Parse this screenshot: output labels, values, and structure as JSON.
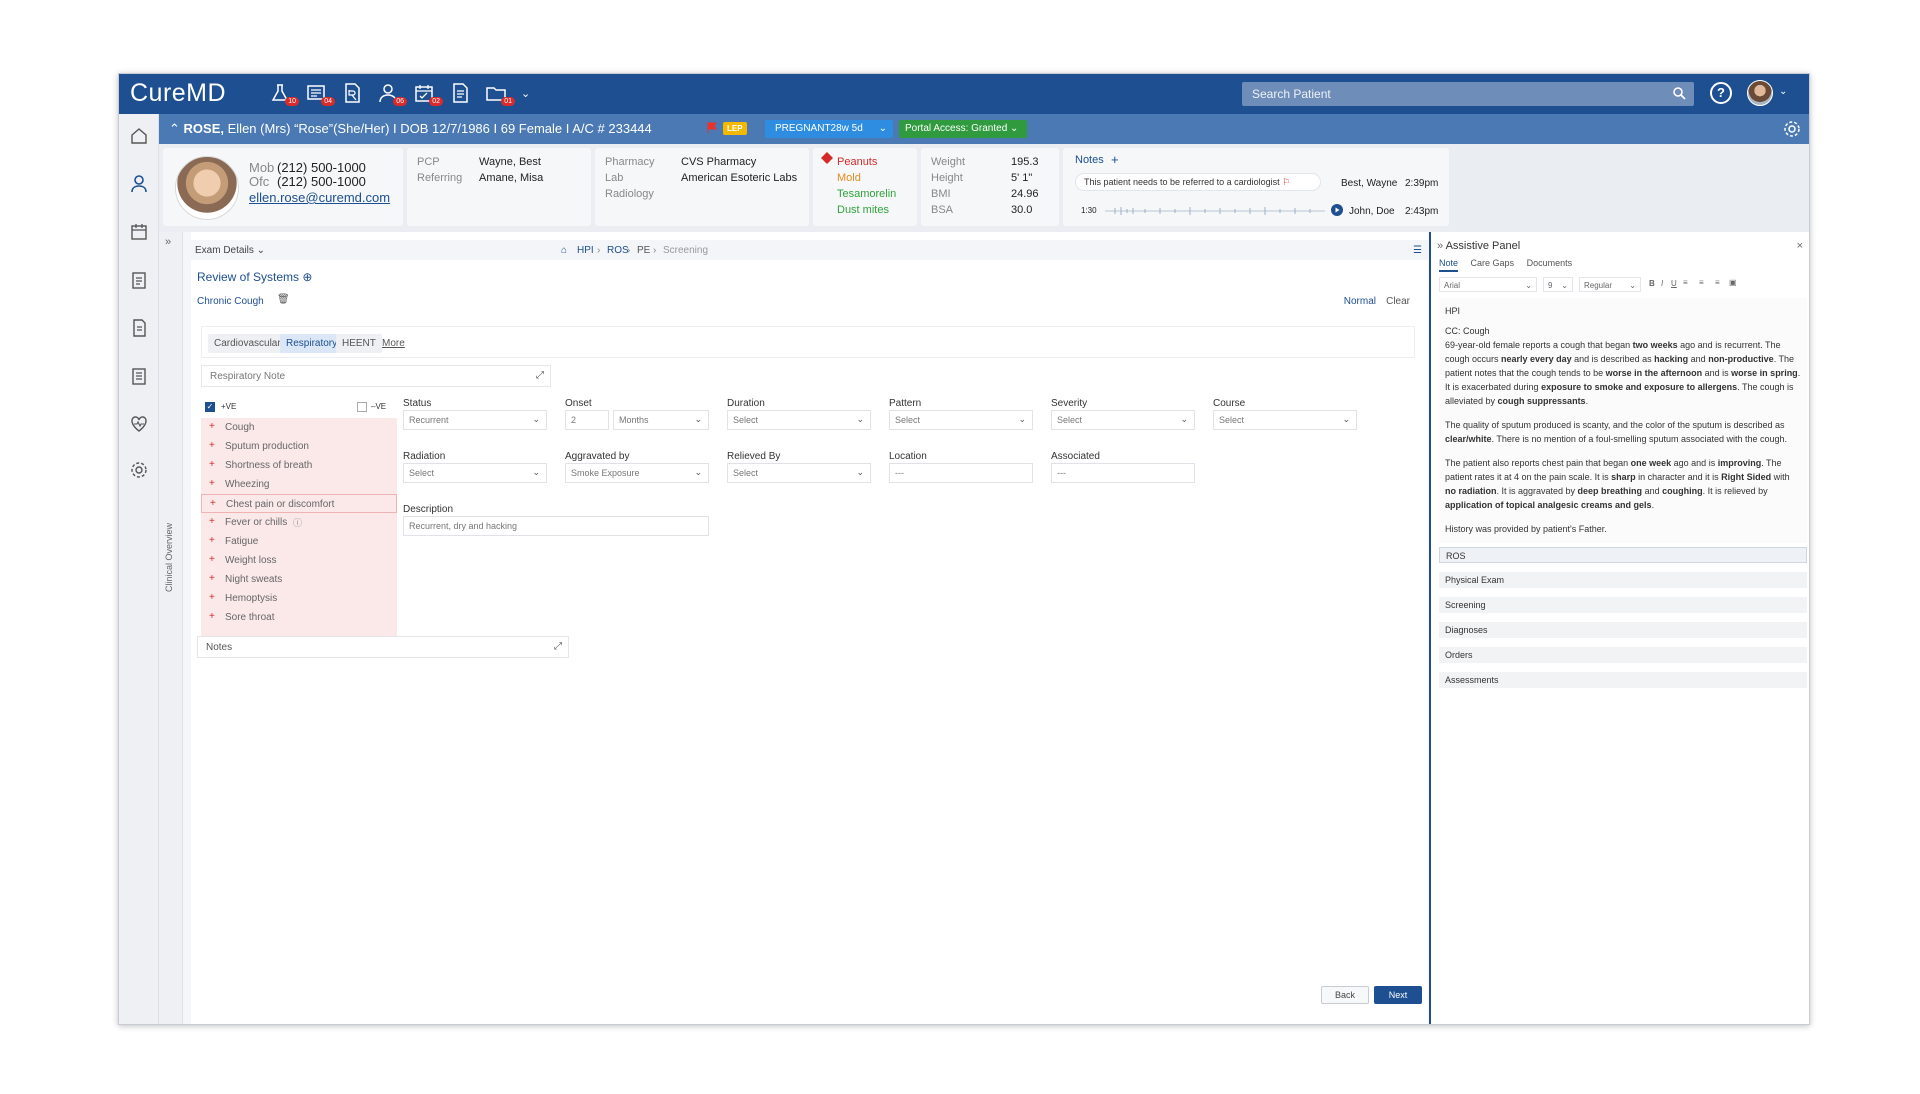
{
  "app": {
    "logo": "CureMD"
  },
  "topbar": {
    "badges": [
      "10",
      "04",
      "",
      "06",
      "02",
      "",
      "01"
    ],
    "search_placeholder": "Search Patient",
    "help": "?"
  },
  "patient": {
    "name": "ROSE,",
    "details": "Ellen (Mrs) “Rose”(She/Her) I DOB 12/7/1986 I  69 Female I  A/C # 233444",
    "lep": "LEP",
    "pregnancy": "PREGNANT28w 5d",
    "portal": "Portal Access: Granted"
  },
  "contact": {
    "mob_label": "Mob",
    "mob": "(212) 500-1000",
    "ofc_label": "Ofc",
    "ofc": "(212) 500-1000",
    "email": "ellen.rose@curemd.com"
  },
  "care": {
    "pcp_label": "PCP",
    "pcp": "Wayne, Best",
    "ref_label": "Referring",
    "ref": "Amane, Misa"
  },
  "pharmacy": {
    "pharm_label": "Pharmacy",
    "pharm": "CVS Pharmacy",
    "lab_label": "Lab",
    "lab": "American Esoteric Labs",
    "rad_label": "Radiology"
  },
  "allergies": [
    "Peanuts",
    "Mold",
    "Tesamorelin",
    "Dust mites"
  ],
  "vitals": [
    {
      "label": "Weight",
      "value": "195.3"
    },
    {
      "label": "Height",
      "value": "5' 1\""
    },
    {
      "label": "BMI",
      "value": "24.96"
    },
    {
      "label": "BSA",
      "value": "30.0"
    }
  ],
  "notes_card": {
    "title": "Notes",
    "note1": "This patient needs to be referred to a cardiologist",
    "note1_author": "Best, Wayne",
    "note1_time": "2:39pm",
    "audio_time": "1:30",
    "note2_author": "John, Doe",
    "note2_time": "2:43pm"
  },
  "breadcrumb": {
    "exam": "Exam Details",
    "items": [
      "HPI",
      "ROS",
      "PE",
      "Screening"
    ]
  },
  "ros": {
    "title": "Review of Systems",
    "problem": "Chronic Cough",
    "normal": "Normal",
    "clear": "Clear",
    "tabs": [
      "Cardiovascular",
      "Respiratory",
      "HEENT",
      "More"
    ],
    "resp_note": "Respiratory Note",
    "pos_label": "+VE",
    "neg_label": "–VE",
    "symptoms": [
      "Cough",
      "Sputum production",
      "Shortness of breath",
      "Wheezing",
      "Chest pain or discomfort",
      "Fever or chills",
      "Fatigue",
      "Weight loss",
      "Night sweats",
      "Hemoptysis",
      "Sore throat"
    ],
    "notes": "Notes"
  },
  "fields": {
    "status": {
      "label": "Status",
      "value": "Recurrent"
    },
    "onset": {
      "label": "Onset",
      "num": "2",
      "unit": "Months"
    },
    "duration": {
      "label": "Duration",
      "value": "Select"
    },
    "pattern": {
      "label": "Pattern",
      "value": "Select"
    },
    "severity": {
      "label": "Severity",
      "value": "Select"
    },
    "course": {
      "label": "Course",
      "value": "Select"
    },
    "radiation": {
      "label": "Radiation",
      "value": "Select"
    },
    "aggravated": {
      "label": "Aggravated by",
      "value": "Smoke Exposure"
    },
    "relieved": {
      "label": "Relieved By",
      "value": "Select"
    },
    "location": {
      "label": "Location",
      "value": "---"
    },
    "associated": {
      "label": "Associated",
      "value": "---"
    },
    "description": {
      "label": "Description",
      "value": "Recurrent, dry and hacking"
    }
  },
  "buttons": {
    "back": "Back",
    "next": "Next"
  },
  "assist": {
    "title": "Assistive Panel",
    "tabs": [
      "Note",
      "Care Gaps",
      "Documents"
    ],
    "font": "Arial",
    "size": "9",
    "weight": "Regular",
    "hpi_label": "HPI",
    "sections": [
      "ROS",
      "Physical Exam",
      "Screening",
      "Diagnoses",
      "Orders",
      "Assessments"
    ]
  },
  "sidebar_label": "Clinical Overview"
}
